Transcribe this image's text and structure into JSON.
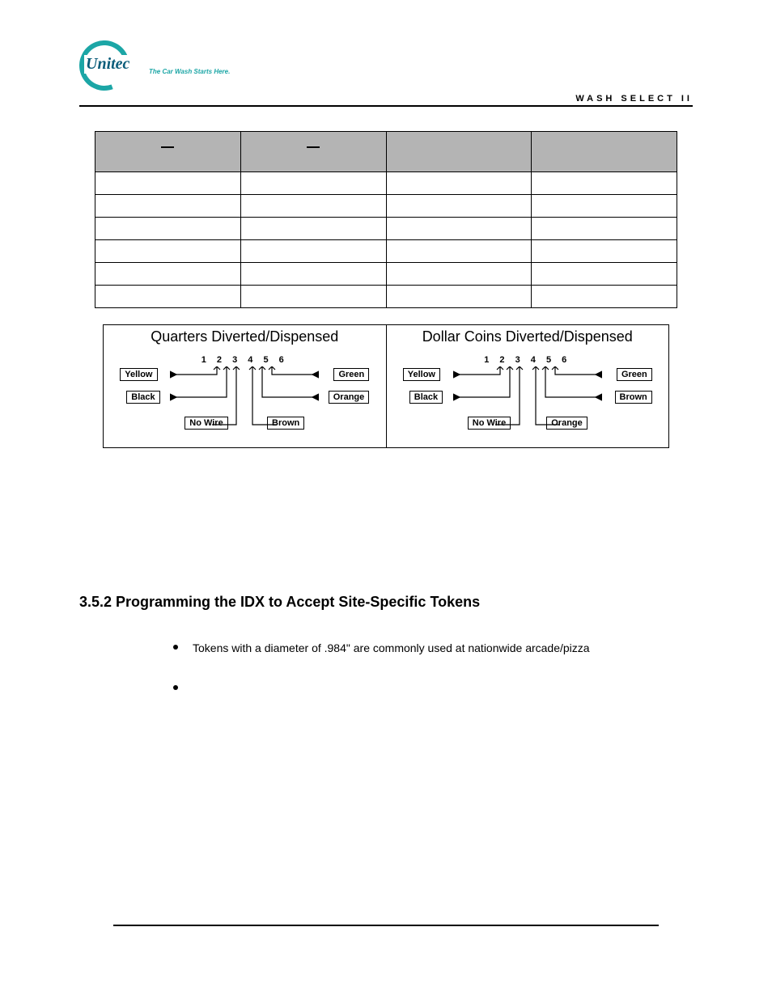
{
  "brand": {
    "name": "Unitec",
    "tagline": "The Car Wash Starts Here."
  },
  "header_title": "WASH SELECT II",
  "pin_table": {
    "headers": [
      "—",
      "—",
      "",
      ""
    ],
    "rows": [
      [
        "",
        "",
        "",
        ""
      ],
      [
        "",
        "",
        "",
        ""
      ],
      [
        "",
        "",
        "",
        ""
      ],
      [
        "",
        "",
        "",
        ""
      ],
      [
        "",
        "",
        "",
        ""
      ],
      [
        "",
        "",
        "",
        ""
      ]
    ]
  },
  "chart_data": [
    {
      "type": "diagram",
      "title": "Quarters Diverted/Dispensed",
      "pin_numbers": "1 2 3 4 5 6",
      "pin_labels": {
        "1": "Yellow",
        "2": "Black",
        "3": "No Wire",
        "4": "Brown",
        "5": "Orange",
        "6": "Green"
      }
    },
    {
      "type": "diagram",
      "title": "Dollar Coins Diverted/Dispensed",
      "pin_numbers": "1 2 3 4 5 6",
      "pin_labels": {
        "1": "Yellow",
        "2": "Black",
        "3": "No Wire",
        "4": "Orange",
        "5": "Brown",
        "6": "Green"
      }
    }
  ],
  "section_heading": "3.5.2 Programming the IDX to Accept Site-Specific Tokens",
  "bullets": [
    "Tokens with a diameter of .984\" are commonly used at nationwide arcade/pizza",
    ""
  ]
}
